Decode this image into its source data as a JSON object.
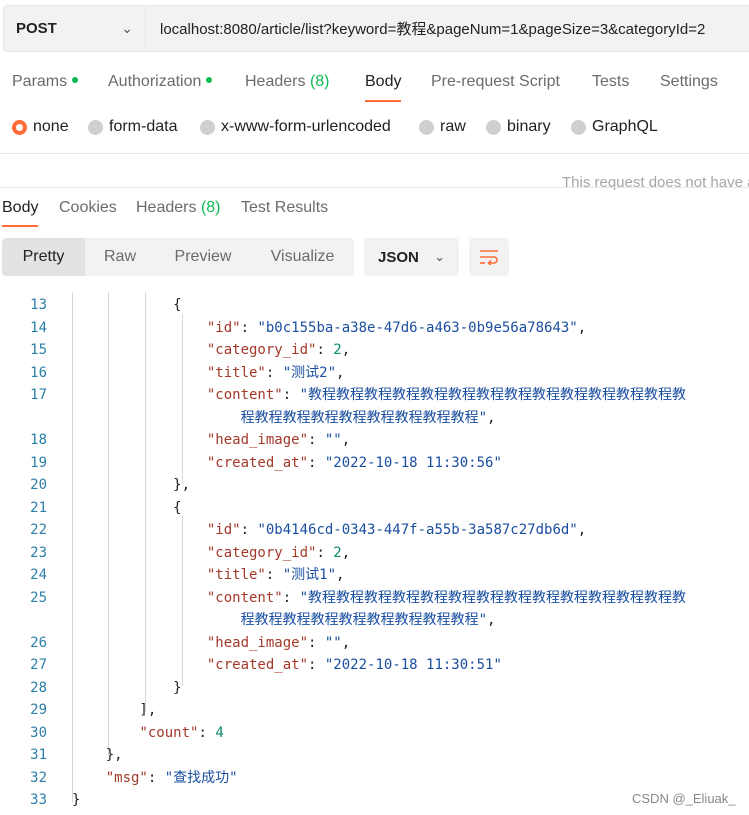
{
  "request": {
    "method": "POST",
    "url": "localhost:8080/article/list?keyword=教程&pageNum=1&pageSize=3&categoryId=2"
  },
  "request_tabs": [
    {
      "label": "Params",
      "dot": true
    },
    {
      "label": "Authorization",
      "dot": true
    },
    {
      "label": "Headers",
      "count": "(8)"
    },
    {
      "label": "Body",
      "active": true
    },
    {
      "label": "Pre-request Script"
    },
    {
      "label": "Tests"
    },
    {
      "label": "Settings"
    }
  ],
  "body_types": [
    {
      "label": "none",
      "selected": true
    },
    {
      "label": "form-data"
    },
    {
      "label": "x-www-form-urlencoded"
    },
    {
      "label": "raw"
    },
    {
      "label": "binary"
    },
    {
      "label": "GraphQL"
    }
  ],
  "body_hint": "This request does not have a body",
  "response_tabs": [
    {
      "label": "Body",
      "active": true
    },
    {
      "label": "Cookies"
    },
    {
      "label": "Headers",
      "count": "(8)"
    },
    {
      "label": "Test Results"
    }
  ],
  "format_options": [
    "Pretty",
    "Raw",
    "Preview",
    "Visualize"
  ],
  "language": "JSON",
  "icons": {
    "method_dropdown": "chevron-down-icon",
    "wrap": "wrap-lines-icon"
  },
  "colors": {
    "accent": "#ff6c37",
    "dot": "#0cbb52",
    "key": "#a4392a",
    "string": "#1a4fa0",
    "number": "#0b8a6e"
  },
  "code_lines": [
    {
      "n": "13",
      "parts": [
        {
          "t": "p",
          "v": "            {"
        }
      ]
    },
    {
      "n": "14",
      "parts": [
        {
          "t": "p",
          "v": "                "
        },
        {
          "t": "k",
          "v": "\"id\""
        },
        {
          "t": "p",
          "v": ": "
        },
        {
          "t": "s",
          "v": "\"b0c155ba-a38e-47d6-a463-0b9e56a78643\""
        },
        {
          "t": "p",
          "v": ","
        }
      ]
    },
    {
      "n": "15",
      "parts": [
        {
          "t": "p",
          "v": "                "
        },
        {
          "t": "k",
          "v": "\"category_id\""
        },
        {
          "t": "p",
          "v": ": "
        },
        {
          "t": "n",
          "v": "2"
        },
        {
          "t": "p",
          "v": ","
        }
      ]
    },
    {
      "n": "16",
      "parts": [
        {
          "t": "p",
          "v": "                "
        },
        {
          "t": "k",
          "v": "\"title\""
        },
        {
          "t": "p",
          "v": ": "
        },
        {
          "t": "s",
          "v": "\"测试2\""
        },
        {
          "t": "p",
          "v": ","
        }
      ]
    },
    {
      "n": "17",
      "parts": [
        {
          "t": "p",
          "v": "                "
        },
        {
          "t": "k",
          "v": "\"content\""
        },
        {
          "t": "p",
          "v": ": "
        },
        {
          "t": "s",
          "v": "\"教程教程教程教程教程教程教程教程教程教程教程教程教程教"
        }
      ]
    },
    {
      "n": "",
      "parts": [
        {
          "t": "s",
          "v": "                    程教程教程教程教程教程教程教程教程\""
        },
        {
          "t": "p",
          "v": ","
        }
      ]
    },
    {
      "n": "18",
      "parts": [
        {
          "t": "p",
          "v": "                "
        },
        {
          "t": "k",
          "v": "\"head_image\""
        },
        {
          "t": "p",
          "v": ": "
        },
        {
          "t": "s",
          "v": "\"\""
        },
        {
          "t": "p",
          "v": ","
        }
      ]
    },
    {
      "n": "19",
      "parts": [
        {
          "t": "p",
          "v": "                "
        },
        {
          "t": "k",
          "v": "\"created_at\""
        },
        {
          "t": "p",
          "v": ": "
        },
        {
          "t": "s",
          "v": "\"2022-10-18 11:30:56\""
        }
      ]
    },
    {
      "n": "20",
      "parts": [
        {
          "t": "p",
          "v": "            },"
        }
      ]
    },
    {
      "n": "21",
      "parts": [
        {
          "t": "p",
          "v": "            {"
        }
      ]
    },
    {
      "n": "22",
      "parts": [
        {
          "t": "p",
          "v": "                "
        },
        {
          "t": "k",
          "v": "\"id\""
        },
        {
          "t": "p",
          "v": ": "
        },
        {
          "t": "s",
          "v": "\"0b4146cd-0343-447f-a55b-3a587c27db6d\""
        },
        {
          "t": "p",
          "v": ","
        }
      ]
    },
    {
      "n": "23",
      "parts": [
        {
          "t": "p",
          "v": "                "
        },
        {
          "t": "k",
          "v": "\"category_id\""
        },
        {
          "t": "p",
          "v": ": "
        },
        {
          "t": "n",
          "v": "2"
        },
        {
          "t": "p",
          "v": ","
        }
      ]
    },
    {
      "n": "24",
      "parts": [
        {
          "t": "p",
          "v": "                "
        },
        {
          "t": "k",
          "v": "\"title\""
        },
        {
          "t": "p",
          "v": ": "
        },
        {
          "t": "s",
          "v": "\"测试1\""
        },
        {
          "t": "p",
          "v": ","
        }
      ]
    },
    {
      "n": "25",
      "parts": [
        {
          "t": "p",
          "v": "                "
        },
        {
          "t": "k",
          "v": "\"content\""
        },
        {
          "t": "p",
          "v": ": "
        },
        {
          "t": "s",
          "v": "\"教程教程教程教程教程教程教程教程教程教程教程教程教程教"
        }
      ]
    },
    {
      "n": "",
      "parts": [
        {
          "t": "s",
          "v": "                    程教程教程教程教程教程教程教程教程\""
        },
        {
          "t": "p",
          "v": ","
        }
      ]
    },
    {
      "n": "26",
      "parts": [
        {
          "t": "p",
          "v": "                "
        },
        {
          "t": "k",
          "v": "\"head_image\""
        },
        {
          "t": "p",
          "v": ": "
        },
        {
          "t": "s",
          "v": "\"\""
        },
        {
          "t": "p",
          "v": ","
        }
      ]
    },
    {
      "n": "27",
      "parts": [
        {
          "t": "p",
          "v": "                "
        },
        {
          "t": "k",
          "v": "\"created_at\""
        },
        {
          "t": "p",
          "v": ": "
        },
        {
          "t": "s",
          "v": "\"2022-10-18 11:30:51\""
        }
      ]
    },
    {
      "n": "28",
      "parts": [
        {
          "t": "p",
          "v": "            }"
        }
      ]
    },
    {
      "n": "29",
      "parts": [
        {
          "t": "p",
          "v": "        ],"
        }
      ]
    },
    {
      "n": "30",
      "parts": [
        {
          "t": "p",
          "v": "        "
        },
        {
          "t": "k",
          "v": "\"count\""
        },
        {
          "t": "p",
          "v": ": "
        },
        {
          "t": "n",
          "v": "4"
        }
      ]
    },
    {
      "n": "31",
      "parts": [
        {
          "t": "p",
          "v": "    },"
        }
      ]
    },
    {
      "n": "32",
      "parts": [
        {
          "t": "p",
          "v": "    "
        },
        {
          "t": "k",
          "v": "\"msg\""
        },
        {
          "t": "p",
          "v": ": "
        },
        {
          "t": "s",
          "v": "\"查找成功\""
        }
      ]
    },
    {
      "n": "33",
      "parts": [
        {
          "t": "p",
          "v": "}"
        }
      ]
    }
  ],
  "watermark": "CSDN @_Eliuak_"
}
